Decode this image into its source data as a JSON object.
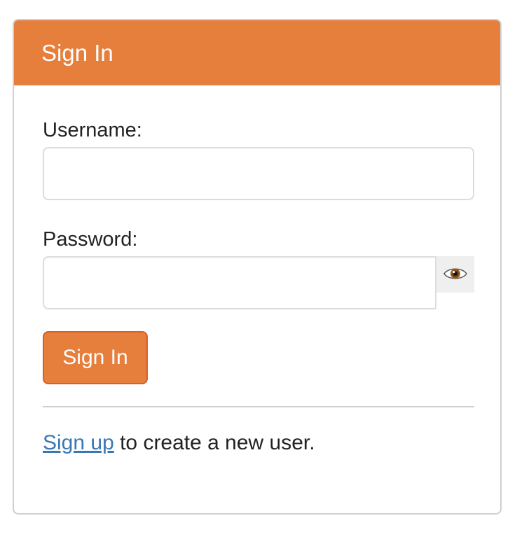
{
  "header": {
    "title": "Sign In"
  },
  "form": {
    "username_label": "Username:",
    "username_value": "",
    "password_label": "Password:",
    "password_value": "",
    "toggle_icon": "eye-icon",
    "submit_label": "Sign In"
  },
  "footer": {
    "signup_link": "Sign up",
    "signup_text": " to create a new user."
  },
  "colors": {
    "accent": "#e67e3c",
    "link": "#3a78b5"
  }
}
